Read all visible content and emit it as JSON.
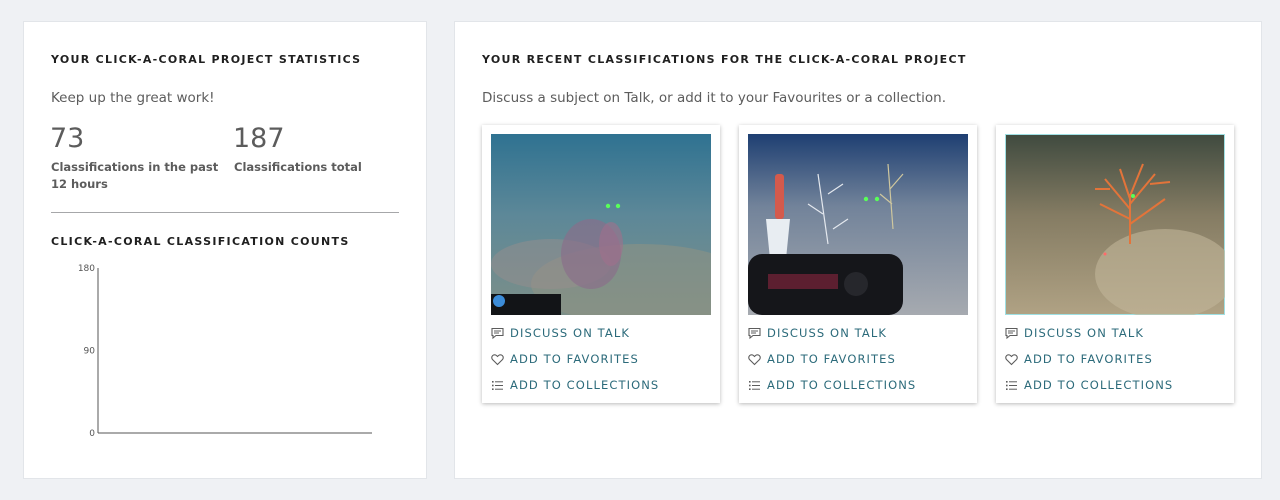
{
  "stats_panel": {
    "heading": "YOUR CLICK-A-CORAL PROJECT STATISTICS",
    "encouragement": "Keep up the great work!",
    "recent_count": "73",
    "recent_label_line1": "Classifications in the past",
    "recent_label_line2": "12 hours",
    "total_count": "187",
    "total_label": "Classifications total",
    "chart_heading": "CLICK-A-CORAL CLASSIFICATION COUNTS"
  },
  "chart_data": {
    "type": "bar",
    "title": "CLICK-A-CORAL CLASSIFICATION COUNTS",
    "categories": [],
    "values": [],
    "ylim": [
      0,
      180
    ],
    "yticks": [
      0,
      90,
      180
    ],
    "tick_labels": [
      "0",
      "90",
      "180"
    ]
  },
  "recent_panel": {
    "heading": "YOUR RECENT CLASSIFICATIONS FOR THE CLICK-A-CORAL PROJECT",
    "instructions": "Discuss a subject on Talk, or add it to your Favourites or a collection."
  },
  "cards": [
    {
      "discuss": "DISCUSS ON TALK",
      "favorite": "ADD TO FAVORITES",
      "collect": "ADD TO COLLECTIONS"
    },
    {
      "discuss": "DISCUSS ON TALK",
      "favorite": "ADD TO FAVORITES",
      "collect": "ADD TO COLLECTIONS"
    },
    {
      "discuss": "DISCUSS ON TALK",
      "favorite": "ADD TO FAVORITES",
      "collect": "ADD TO COLLECTIONS"
    }
  ],
  "icons": {
    "discuss": "speech-bubble-icon",
    "favorite": "heart-icon",
    "collect": "list-icon"
  },
  "colors": {
    "accent": "#2b6a7a",
    "page_background": "#eff1f4"
  }
}
